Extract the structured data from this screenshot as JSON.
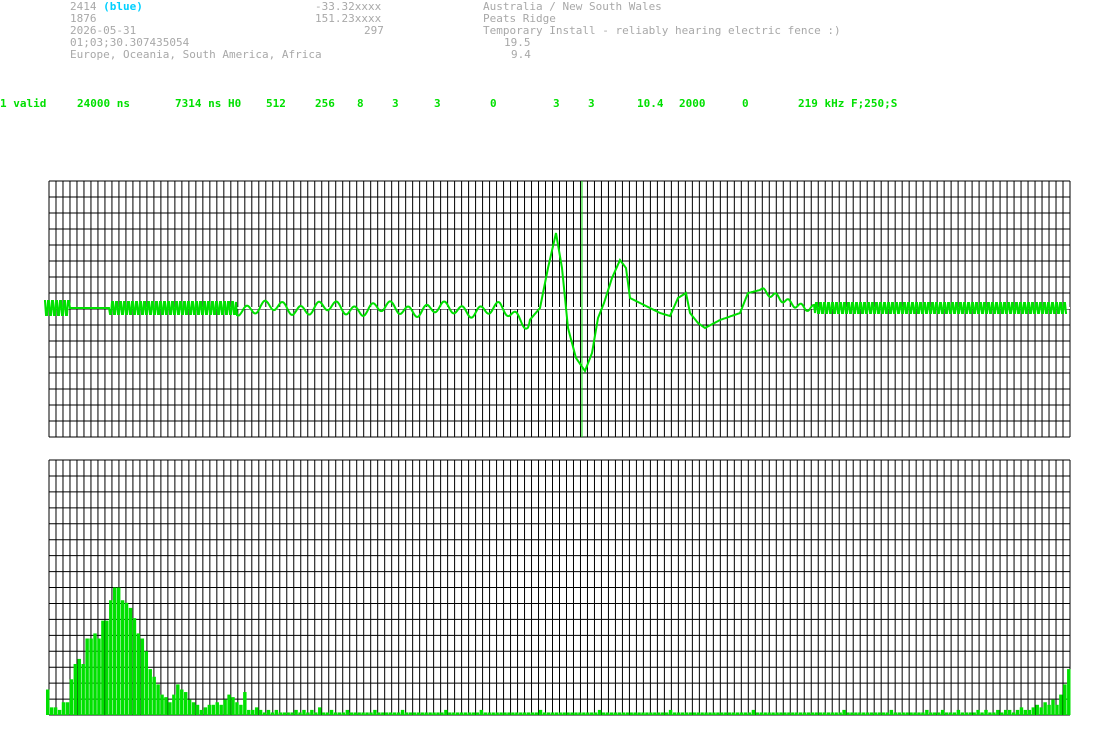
{
  "station": {
    "id": "2414",
    "color_name": "(blue)",
    "number": "1876",
    "date": "2026-05-31",
    "time": "01;03;30.307435054",
    "regions": "Europe, Oceania, South America, Africa",
    "lat": "-33.32xxxx",
    "lon": "151.23xxxx",
    "alt": "297",
    "country": "Australia / New South Wales",
    "place": "Peats Ridge",
    "comment": "Temporary Install - reliably hearing electric fence :)",
    "val1": "19.5",
    "val2": "9.4"
  },
  "stats": [
    "1 valid",
    "24000 ns",
    "7314 ns H0",
    "512",
    "256",
    "8",
    "3",
    "3",
    "0",
    "3",
    "3",
    "10.4",
    "2000",
    "0",
    "219 kHz F;250;S"
  ],
  "colors": {
    "grid": "#000000",
    "signal": "#00e000",
    "baseline": "#ffffff",
    "info_text": "#a8a8a8",
    "station_color": "#00d0ff"
  },
  "waveform_panel": {
    "marker_position": 0.522
  },
  "spectrum": {
    "levels": [
      0.1,
      0.03,
      0.03,
      0.02,
      0.05,
      0.05,
      0.14,
      0.2,
      0.22,
      0.2,
      0.3,
      0.3,
      0.32,
      0.3,
      0.37,
      0.37,
      0.45,
      0.5,
      0.5,
      0.45,
      0.44,
      0.42,
      0.38,
      0.32,
      0.3,
      0.25,
      0.18,
      0.15,
      0.12,
      0.08,
      0.07,
      0.05,
      0.08,
      0.12,
      0.1,
      0.09,
      0.06,
      0.05,
      0.04,
      0.02,
      0.03,
      0.04,
      0.04,
      0.05,
      0.04,
      0.06,
      0.08,
      0.07,
      0.05,
      0.04,
      0.09,
      0.02,
      0.02,
      0.03,
      0.02,
      0.01,
      0.02,
      0.01,
      0.02,
      0.01,
      0.01,
      0.01,
      0.01,
      0.02,
      0.01,
      0.02,
      0.01,
      0.02,
      0.01,
      0.03,
      0.01,
      0.01,
      0.02,
      0.01,
      0.01,
      0.01,
      0.02,
      0.01,
      0.01,
      0.01,
      0.01,
      0.01,
      0.01,
      0.02,
      0.01,
      0.01,
      0.01,
      0.01,
      0.01,
      0.01,
      0.02,
      0.01,
      0.01,
      0.01,
      0.01,
      0.01,
      0.01,
      0.01,
      0.01,
      0.01,
      0.01,
      0.02,
      0.01,
      0.01,
      0.01,
      0.01,
      0.01,
      0.01,
      0.01,
      0.01,
      0.02,
      0.01,
      0.01,
      0.01,
      0.01,
      0.01,
      0.01,
      0.01,
      0.01,
      0.01,
      0.01,
      0.01,
      0.01,
      0.01,
      0.01,
      0.02,
      0.01,
      0.01,
      0.01,
      0.01,
      0.01,
      0.01,
      0.01,
      0.01,
      0.01,
      0.01,
      0.01,
      0.01,
      0.01,
      0.01,
      0.02,
      0.01,
      0.01,
      0.01,
      0.01,
      0.01,
      0.01,
      0.01,
      0.01,
      0.01,
      0.01,
      0.01,
      0.01,
      0.01,
      0.01,
      0.01,
      0.01,
      0.01,
      0.02,
      0.01,
      0.01,
      0.01,
      0.01,
      0.01,
      0.01,
      0.01,
      0.01,
      0.01,
      0.01,
      0.01,
      0.01,
      0.01,
      0.01,
      0.01,
      0.01,
      0.01,
      0.01,
      0.01,
      0.01,
      0.02,
      0.01,
      0.01,
      0.01,
      0.01,
      0.01,
      0.01,
      0.01,
      0.01,
      0.01,
      0.01,
      0.01,
      0.01,
      0.01,
      0.01,
      0.01,
      0.01,
      0.01,
      0.01,
      0.01,
      0.01,
      0.01,
      0.01,
      0.02,
      0.01,
      0.01,
      0.01,
      0.01,
      0.01,
      0.01,
      0.01,
      0.01,
      0.01,
      0.01,
      0.01,
      0.02,
      0.01,
      0.01,
      0.01,
      0.01,
      0.01,
      0.01,
      0.01,
      0.01,
      0.02,
      0.01,
      0.01,
      0.01,
      0.02,
      0.01,
      0.01,
      0.01,
      0.02,
      0.01,
      0.01,
      0.01,
      0.01,
      0.02,
      0.01,
      0.02,
      0.01,
      0.01,
      0.02,
      0.01,
      0.02,
      0.02,
      0.01,
      0.02,
      0.03,
      0.02,
      0.02,
      0.03,
      0.04,
      0.03,
      0.05,
      0.04,
      0.06,
      0.04,
      0.08,
      0.12,
      0.18
    ]
  }
}
